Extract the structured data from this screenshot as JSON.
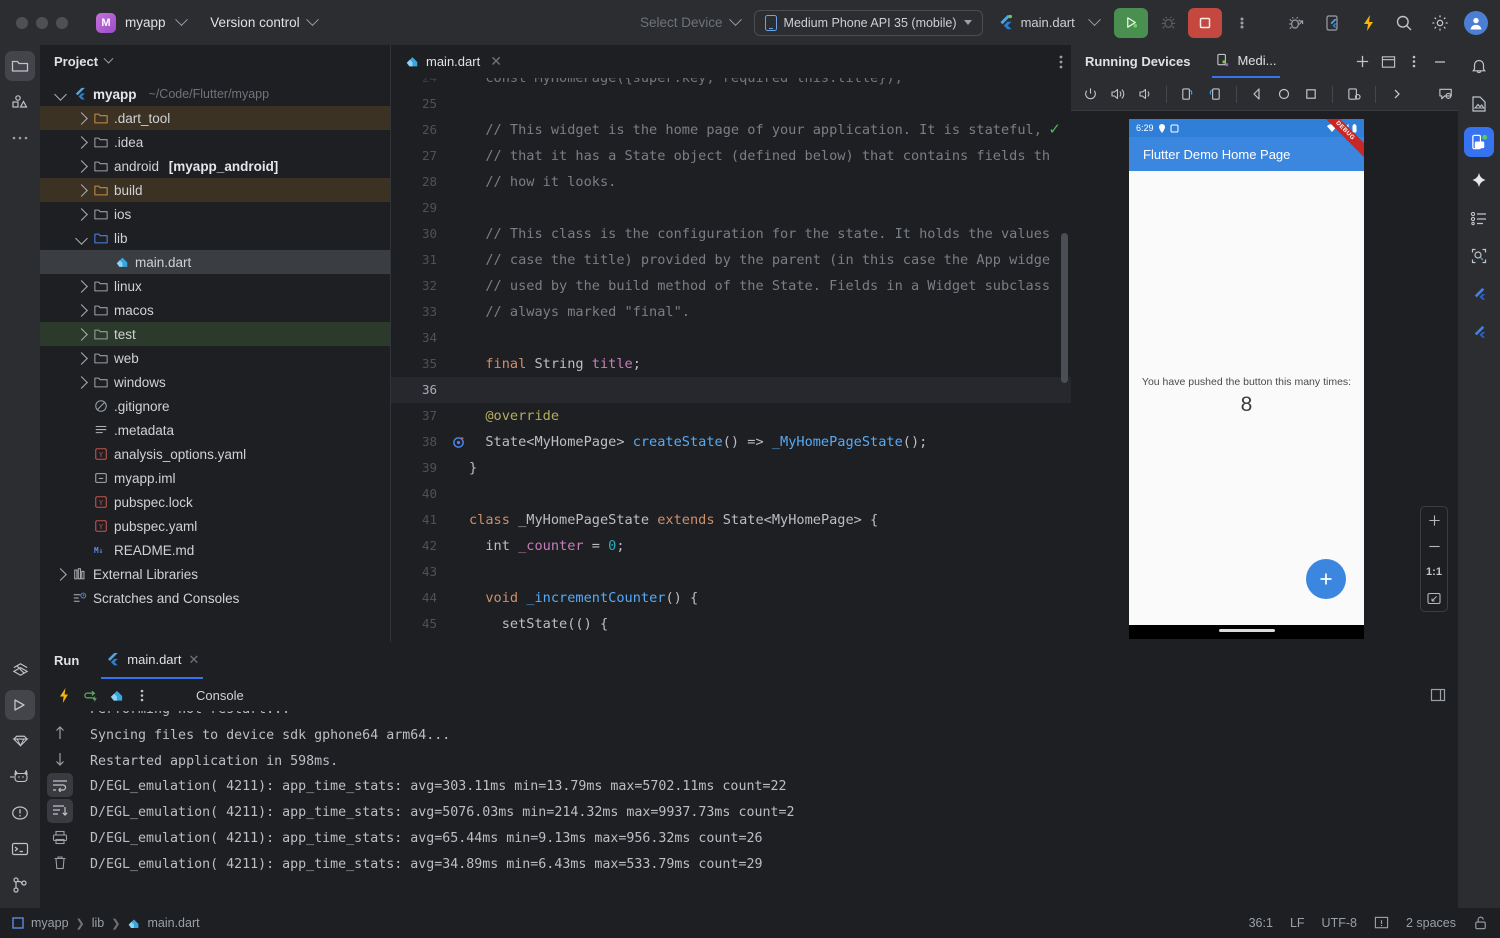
{
  "titlebar": {
    "app_badge": "M",
    "project_name": "myapp",
    "version_control": "Version control",
    "select_device": "Select Device",
    "device_selector": "Medium Phone API 35 (mobile)",
    "run_config": "main.dart",
    "icons": [
      "run-icon",
      "debug-icon",
      "stop-icon",
      "more-icon",
      "debug-flutter-icon",
      "flutter-device-icon",
      "hot-reload-icon",
      "search-icon",
      "settings-icon",
      "avatar-icon"
    ]
  },
  "left_toolbar": {
    "top": [
      "project-icon",
      "commit-icon",
      "more-tool-windows-icon"
    ],
    "bottom": [
      "flutter-outline-icon",
      "run-icon",
      "dart-analysis-icon",
      "meow-icon",
      "problems-icon",
      "terminal-icon",
      "git-branch-icon"
    ]
  },
  "right_toolbar": {
    "items": [
      "notifications-icon",
      "device-manager-icon",
      "running-devices-icon",
      "ai-assistant-icon",
      "todo-icon",
      "flutter-inspector-icon",
      "flutter-performance-icon",
      "flutter-devtools-icon"
    ]
  },
  "project_panel": {
    "title": "Project",
    "root": {
      "label": "myapp",
      "path": "~/Code/Flutter/myapp"
    },
    "items": [
      {
        "label": ".dart_tool",
        "indent": 1,
        "arrow": "closed",
        "icon": "folder-excluded-icon",
        "hl": "ignored"
      },
      {
        "label": ".idea",
        "indent": 1,
        "arrow": "closed",
        "icon": "folder-idea-icon",
        "hl": "none"
      },
      {
        "label": "android",
        "indent": 1,
        "arrow": "closed",
        "icon": "folder-icon",
        "hl": "none",
        "suffix": "[myapp_android]"
      },
      {
        "label": "build",
        "indent": 1,
        "arrow": "closed",
        "icon": "folder-excluded-icon",
        "hl": "ignored"
      },
      {
        "label": "ios",
        "indent": 1,
        "arrow": "closed",
        "icon": "folder-icon",
        "hl": "none"
      },
      {
        "label": "lib",
        "indent": 1,
        "arrow": "open",
        "icon": "folder-source-icon",
        "hl": "none"
      },
      {
        "label": "main.dart",
        "indent": 2,
        "arrow": "none",
        "icon": "dart-file-icon",
        "hl": "selected"
      },
      {
        "label": "linux",
        "indent": 1,
        "arrow": "closed",
        "icon": "folder-icon",
        "hl": "none"
      },
      {
        "label": "macos",
        "indent": 1,
        "arrow": "closed",
        "icon": "folder-icon",
        "hl": "none"
      },
      {
        "label": "test",
        "indent": 1,
        "arrow": "closed",
        "icon": "folder-test-icon",
        "hl": "test"
      },
      {
        "label": "web",
        "indent": 1,
        "arrow": "closed",
        "icon": "folder-web-icon",
        "hl": "none"
      },
      {
        "label": "windows",
        "indent": 1,
        "arrow": "closed",
        "icon": "folder-icon",
        "hl": "none"
      },
      {
        "label": ".gitignore",
        "indent": 1,
        "arrow": "none",
        "icon": "gitignore-icon",
        "hl": "none"
      },
      {
        "label": ".metadata",
        "indent": 1,
        "arrow": "none",
        "icon": "text-file-icon",
        "hl": "none"
      },
      {
        "label": "analysis_options.yaml",
        "indent": 1,
        "arrow": "none",
        "icon": "yaml-file-icon",
        "hl": "none"
      },
      {
        "label": "myapp.iml",
        "indent": 1,
        "arrow": "none",
        "icon": "iml-file-icon",
        "hl": "none"
      },
      {
        "label": "pubspec.lock",
        "indent": 1,
        "arrow": "none",
        "icon": "yaml-file-icon",
        "hl": "none"
      },
      {
        "label": "pubspec.yaml",
        "indent": 1,
        "arrow": "none",
        "icon": "yaml-file-icon",
        "hl": "none"
      },
      {
        "label": "README.md",
        "indent": 1,
        "arrow": "none",
        "icon": "markdown-file-icon",
        "hl": "none"
      },
      {
        "label": "External Libraries",
        "indent": 0,
        "arrow": "closed",
        "icon": "libraries-icon",
        "hl": "none"
      },
      {
        "label": "Scratches and Consoles",
        "indent": 0,
        "arrow": "none",
        "icon": "scratches-icon",
        "hl": "none"
      }
    ]
  },
  "editor": {
    "tab_label": "main.dart",
    "lines": [
      {
        "n": "24",
        "cur": false,
        "cut": true,
        "tokens": [
          {
            "t": "  const MyHomePage({super.key, required this.title});",
            "c": "typ"
          }
        ]
      },
      {
        "n": "25",
        "cur": false,
        "tokens": []
      },
      {
        "n": "26",
        "cur": false,
        "tokens": [
          {
            "t": "  // This widget is the home page of your application. It is stateful,",
            "c": "cmt"
          }
        ]
      },
      {
        "n": "27",
        "cur": false,
        "tokens": [
          {
            "t": "  // that it has a State object (defined below) that contains fields th",
            "c": "cmt"
          }
        ]
      },
      {
        "n": "28",
        "cur": false,
        "tokens": [
          {
            "t": "  // how it looks.",
            "c": "cmt"
          }
        ]
      },
      {
        "n": "29",
        "cur": false,
        "tokens": []
      },
      {
        "n": "30",
        "cur": false,
        "tokens": [
          {
            "t": "  // This class is the configuration for the state. It holds the values",
            "c": "cmt"
          }
        ]
      },
      {
        "n": "31",
        "cur": false,
        "tokens": [
          {
            "t": "  // case the title) provided by the parent (in this case the App widge",
            "c": "cmt"
          }
        ]
      },
      {
        "n": "32",
        "cur": false,
        "tokens": [
          {
            "t": "  // used by the build method of the State. Fields in a Widget subclass",
            "c": "cmt"
          }
        ]
      },
      {
        "n": "33",
        "cur": false,
        "tokens": [
          {
            "t": "  // always marked \"final\".",
            "c": "cmt"
          }
        ]
      },
      {
        "n": "34",
        "cur": false,
        "tokens": []
      },
      {
        "n": "35",
        "cur": false,
        "tokens": [
          {
            "t": "  ",
            "c": "typ"
          },
          {
            "t": "final",
            "c": "kw"
          },
          {
            "t": " String ",
            "c": "typ"
          },
          {
            "t": "title",
            "c": "fld"
          },
          {
            "t": ";",
            "c": "typ"
          }
        ]
      },
      {
        "n": "36",
        "cur": true,
        "tokens": []
      },
      {
        "n": "37",
        "cur": false,
        "tokens": [
          {
            "t": "  ",
            "c": "typ"
          },
          {
            "t": "@override",
            "c": "ann"
          }
        ]
      },
      {
        "n": "38",
        "cur": false,
        "gutter_icon": "override-marker-icon",
        "tokens": [
          {
            "t": "  State<MyHomePage> ",
            "c": "typ"
          },
          {
            "t": "createState",
            "c": "fn"
          },
          {
            "t": "() => ",
            "c": "typ"
          },
          {
            "t": "_MyHomePageState",
            "c": "fn"
          },
          {
            "t": "();",
            "c": "typ"
          }
        ]
      },
      {
        "n": "39",
        "cur": false,
        "tokens": [
          {
            "t": "}",
            "c": "typ"
          }
        ]
      },
      {
        "n": "40",
        "cur": false,
        "tokens": []
      },
      {
        "n": "41",
        "cur": false,
        "tokens": [
          {
            "t": "class",
            "c": "kw"
          },
          {
            "t": " _MyHomePageState ",
            "c": "typ"
          },
          {
            "t": "extends",
            "c": "kw"
          },
          {
            "t": " State<MyHomePage> {",
            "c": "typ"
          }
        ]
      },
      {
        "n": "42",
        "cur": false,
        "tokens": [
          {
            "t": "  int ",
            "c": "typ"
          },
          {
            "t": "_counter",
            "c": "fld"
          },
          {
            "t": " = ",
            "c": "typ"
          },
          {
            "t": "0",
            "c": "num"
          },
          {
            "t": ";",
            "c": "typ"
          }
        ]
      },
      {
        "n": "43",
        "cur": false,
        "tokens": []
      },
      {
        "n": "44",
        "cur": false,
        "tokens": [
          {
            "t": "  ",
            "c": "typ"
          },
          {
            "t": "void",
            "c": "kw"
          },
          {
            "t": " ",
            "c": "typ"
          },
          {
            "t": "_incrementCounter",
            "c": "fn"
          },
          {
            "t": "() {",
            "c": "typ"
          }
        ]
      },
      {
        "n": "45",
        "cur": false,
        "tokens": [
          {
            "t": "    setState(() {",
            "c": "typ"
          }
        ]
      }
    ]
  },
  "devices_panel": {
    "title": "Running Devices",
    "tab_label": "Medi...",
    "header_icons": [
      "add-device-icon",
      "split-view-icon",
      "more-icon",
      "minimize-icon"
    ],
    "toolbar_icons": [
      "power-icon",
      "volume-up-icon",
      "volume-down-icon",
      "rotate-left-icon",
      "rotate-right-icon",
      "back-icon",
      "home-icon",
      "recents-icon",
      "screenshot-icon",
      "more-actions-icon",
      "inspect-icon"
    ],
    "zoom_controls": [
      "zoom-in-icon",
      "zoom-out-icon",
      "actual-size",
      "fit-to-screen-icon"
    ],
    "zoom_actual_label": "1:1",
    "device_screen": {
      "status_time": "6:29",
      "app_bar_title": "Flutter Demo Home Page",
      "body_text": "You have pushed the button this many times:",
      "counter": "8",
      "fab_icon": "add-icon",
      "debug_banner": "DEBUG"
    }
  },
  "run_panel": {
    "title": "Run",
    "tab_label": "main.dart",
    "toolbar_icons": [
      "hot-reload-icon",
      "hot-restart-icon",
      "open-devtools-icon",
      "more-icon"
    ],
    "console_label": "Console",
    "right_icon": "layout-icon",
    "gutter_icons": [
      "scroll-up-icon",
      "scroll-down-icon",
      "soft-wrap-icon",
      "scroll-to-end-icon",
      "print-icon",
      "clear-all-icon"
    ],
    "log": [
      "Performing hot restart...",
      "Syncing files to device sdk gphone64 arm64...",
      "Restarted application in 598ms.",
      "D/EGL_emulation( 4211): app_time_stats: avg=303.11ms min=13.79ms max=5702.11ms count=22",
      "D/EGL_emulation( 4211): app_time_stats: avg=5076.03ms min=214.32ms max=9937.73ms count=2",
      "D/EGL_emulation( 4211): app_time_stats: avg=65.44ms min=9.13ms max=956.32ms count=26",
      "D/EGL_emulation( 4211): app_time_stats: avg=34.89ms min=6.43ms max=533.79ms count=29"
    ]
  },
  "status_bar": {
    "breadcrumb": [
      "myapp",
      "lib",
      "main.dart"
    ],
    "caret_position": "36:1",
    "line_separator": "LF",
    "encoding": "UTF-8",
    "indent": "2 spaces",
    "icons": [
      "inspection-icon",
      "lock-icon"
    ]
  },
  "colors": {
    "accent": "#3573f0",
    "run_green": "#4a8f50",
    "stop_red": "#c4483f",
    "flutter_blue": "#3b87e0",
    "ignored_bg": "#3c3223",
    "test_bg": "#2b3a2b"
  }
}
